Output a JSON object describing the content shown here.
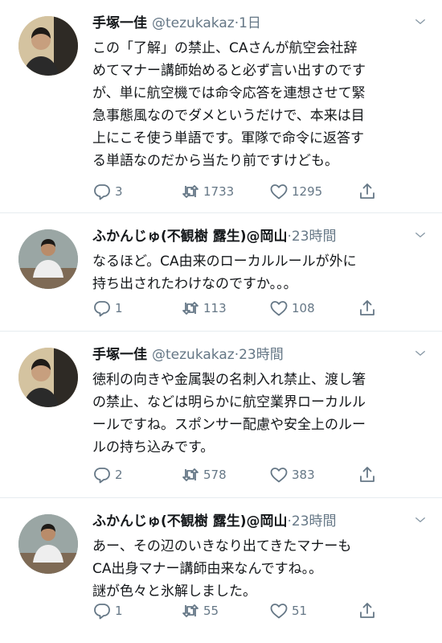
{
  "tweets": [
    {
      "name": "手塚一佳",
      "handle": "@tezukakaz",
      "dot": "·",
      "time": "1日",
      "text": "この「了解」の禁止、CAさんが航空会社辞\nめてマナー講師始めると必ず言い出すのです\nが、単に航空機では命令応答を連想させて緊\n急事態風なのでダメというだけで、本来は目\n上にこそ使う単語です。軍隊で命令に返答す\nる単語なのだから当たり前ですけども。",
      "replies": "3",
      "retweets": "1733",
      "likes": "1295"
    },
    {
      "name": "ふかんじゅ(不観樹 露生)@岡山",
      "handle": "",
      "dot": "·",
      "time": "23時間",
      "text": "なるほど。CA由来のローカルルールが外に\n持ち出されたわけなのですか。。。",
      "replies": "1",
      "retweets": "113",
      "likes": "108"
    },
    {
      "name": "手塚一佳",
      "handle": "@tezukakaz",
      "dot": "·",
      "time": "23時間",
      "text": "徳利の向きや金属製の名刺入れ禁止、渡し箸\nの禁止、などは明らかに航空業界ローカルル\nールですね。スポンサー配慮や安全上のルー\nルの持ち込みです。",
      "replies": "2",
      "retweets": "578",
      "likes": "383"
    },
    {
      "name": "ふかんじゅ(不観樹 露生)@岡山",
      "handle": "",
      "dot": "·",
      "time": "23時間",
      "text": "あー、その辺のいきなり出てきたマナーも\nCA出身マナー講師由来なんですね。。\n謎が色々と氷解しました。",
      "replies": "1",
      "retweets": "55",
      "likes": "51"
    }
  ]
}
